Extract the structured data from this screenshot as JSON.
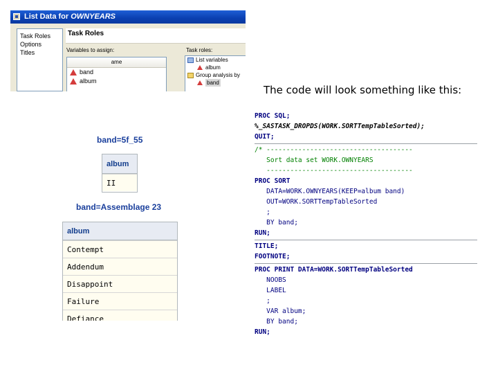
{
  "dialog": {
    "title_prefix": "List Data for ",
    "title_dataset": "OWNYEARS",
    "nav_items": [
      "Task Roles",
      "Options",
      "Titles"
    ],
    "panel_title": "Task Roles",
    "variables_label": "Variables to assign:",
    "variables_header": "ame",
    "variables": [
      "band",
      "album"
    ],
    "task_roles_label": "Task roles:",
    "task_roles": [
      {
        "icon": "list-variables-icon",
        "label": "List variables"
      },
      {
        "icon": "variable-icon",
        "label": "album",
        "indent": true
      },
      {
        "icon": "group-icon",
        "label": "Group analysis by"
      },
      {
        "icon": "variable-icon",
        "label": "band",
        "indent": true,
        "selected": true
      }
    ]
  },
  "caption": "The code will look something like this:",
  "output": {
    "group1": {
      "title": "band=5f_55",
      "header": "album",
      "rows": [
        "II"
      ]
    },
    "group2": {
      "title": "band=Assemblage 23",
      "header": "album",
      "rows": [
        "Contempt",
        "Addendum",
        "Disappoint",
        "Failure",
        "Defiance"
      ]
    }
  },
  "code": {
    "block1": [
      "PROC SQL;",
      "%_SASTASK_DROPDS(WORK.SORTTempTableSorted);",
      "QUIT;"
    ],
    "block2": [
      "/* -------------------------------------",
      "   Sort data set WORK.OWNYEARS",
      "   -------------------------------------",
      "PROC SORT",
      "   DATA=WORK.OWNYEARS(KEEP=album band)",
      "   OUT=WORK.SORTTempTableSorted",
      "   ;",
      "   BY band;",
      "RUN;"
    ],
    "block3": [
      "TITLE;",
      "FOOTNOTE;"
    ],
    "block4": [
      "PROC PRINT DATA=WORK.SORTTempTableSorted",
      "   NOOBS",
      "   LABEL",
      "   ;",
      "   VAR album;",
      "   BY band;",
      "RUN;"
    ]
  }
}
